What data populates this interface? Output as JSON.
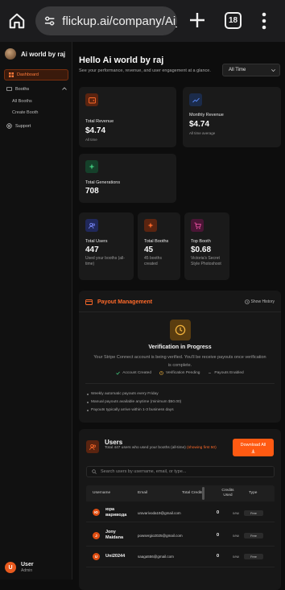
{
  "browser": {
    "url": "flickup.ai/company/Ai_",
    "tab_count": "18"
  },
  "sidebar": {
    "brand_name": "Ai world by raj",
    "nav": {
      "dashboard": "Dashboard",
      "booths": "Booths",
      "all_booths": "All Booths",
      "create_booth": "Create Booth",
      "support": "Support"
    },
    "user": {
      "initial": "U",
      "name": "User",
      "role": "Admin"
    }
  },
  "header": {
    "title": "Hello Ai world by raj",
    "subtitle": "See your performance, revenue, and user engagement at a glance.",
    "period": "All Time"
  },
  "stats": {
    "total_revenue": {
      "label": "Total Revenue",
      "value": "$4.74",
      "note": "All time"
    },
    "monthly_revenue": {
      "label": "Monthly Revenue",
      "value": "$4.74",
      "note": "All time average"
    },
    "total_generations": {
      "label": "Total Generations",
      "value": "708"
    },
    "total_users": {
      "label": "Total Users",
      "value": "447",
      "note": "Used your booths (all-time)"
    },
    "total_booths": {
      "label": "Total Booths",
      "value": "45",
      "note": "45 booths created"
    },
    "top_booth": {
      "label": "Top Booth",
      "value": "$0.68",
      "note": "Victoria's Secret Style Photoshoot"
    }
  },
  "payout": {
    "title": "Payout Management",
    "history_label": "Show History",
    "status_title": "Verification in Progress",
    "status_desc": "Your Stripe Connect account is being verified. You'll be receive payouts once verification is complete.",
    "steps": [
      "Account Created",
      "Verification Pending",
      "Payouts Enabled"
    ],
    "bullets": [
      "Weekly automatic payouts every Friday",
      "Manual payouts available anytime (minimum $50.00)",
      "Payouts typically arrive within 1-3 business days"
    ]
  },
  "users": {
    "title": "Users",
    "desc_prefix": "Total 447 users who used your booths (all-time)",
    "desc_highlight": "(showing first 50)",
    "download_label": "Download All",
    "search_placeholder": "Search users by username, email, or type...",
    "columns": {
      "username": "Username",
      "email": "Email",
      "total_credits": "Total Credits",
      "credits_used": "Credits Used",
      "type": "Type"
    },
    "rows": [
      {
        "initial": "Ю",
        "name": "юра варивода",
        "email": "uravarivoda19@gmail.com",
        "credits": "0",
        "used": "0/Nil",
        "type": "Free"
      },
      {
        "initial": "J",
        "name": "Jony Maidana",
        "email": "powsergio2025@gmail.com",
        "credits": "0",
        "used": "0/Nil",
        "type": "Free"
      },
      {
        "initial": "U",
        "name": "Uni20244",
        "email": "saaga556@gmail.com",
        "credits": "0",
        "used": "0/Nil",
        "type": "Free"
      }
    ]
  },
  "colors": {
    "accent": "#ff5a12",
    "background": "#0d0d0d",
    "card": "#1a1a1a"
  }
}
